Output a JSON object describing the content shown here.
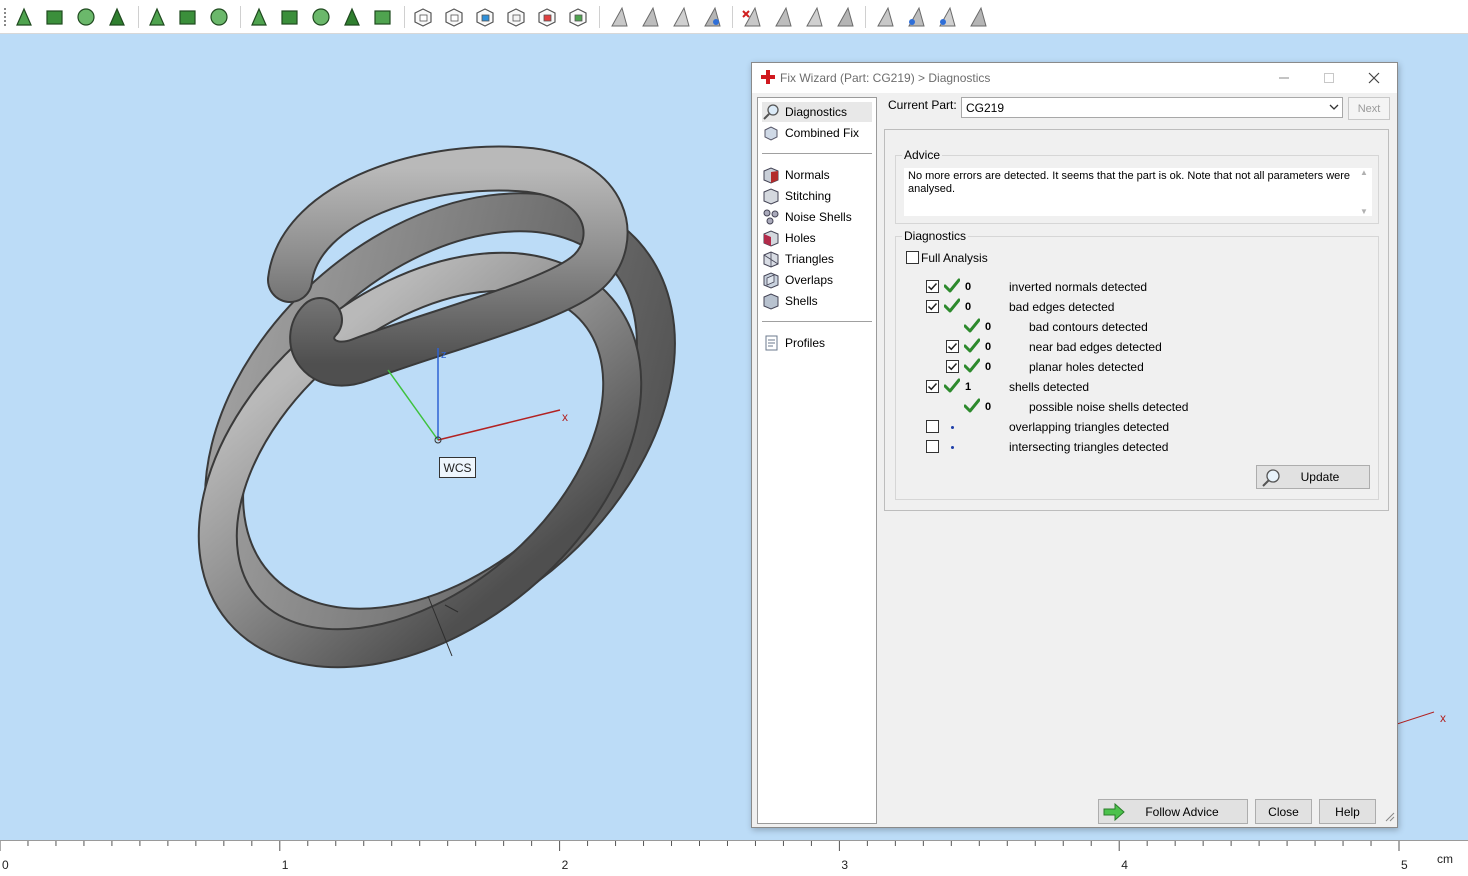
{
  "toolbar": {
    "groups": [
      [
        "arrow-select-icon",
        "face-select-icon",
        "edge-select-icon",
        "shell-select-icon"
      ],
      [
        "plane-select-icon",
        "connected-select-icon",
        "curve-select-icon"
      ],
      [
        "triangle-select-icon",
        "surface-select-icon",
        "star-select-icon",
        "radial-select-icon",
        "sector-select-icon"
      ],
      [
        "box-view-icon",
        "cube-view-icon",
        "cube-color-icon",
        "wire-cube-icon",
        "cube-red-icon",
        "cube-green-icon"
      ],
      [
        "triangle-tool-1-icon",
        "triangle-tool-2-icon",
        "triangle-tool-3-icon",
        "triangle-warning-icon"
      ],
      [
        "triangle-delete-icon",
        "triangle-tool-4-icon",
        "triangle-tool-5-icon",
        "triangle-tool-6-icon"
      ],
      [
        "triangle-outline-icon",
        "triangle-blue-icon",
        "triangle-point-icon",
        "triangle-gray-icon"
      ]
    ]
  },
  "viewport": {
    "axis_x_label": "x",
    "axis_z_label": "z",
    "wcs_label": "WCS",
    "far_axis_label": "x"
  },
  "ruler": {
    "labels": [
      "0",
      "1",
      "2",
      "3",
      "4",
      "5"
    ],
    "unit": "cm"
  },
  "dialog": {
    "title": "Fix Wizard (Part: CG219) > Diagnostics",
    "nav": {
      "top": [
        {
          "label": "Diagnostics",
          "icon": "magnifier-icon",
          "active": true
        },
        {
          "label": "Combined Fix",
          "icon": "combined-fix-icon",
          "active": false
        }
      ],
      "fixes": [
        {
          "label": "Normals",
          "icon": "normals-icon"
        },
        {
          "label": "Stitching",
          "icon": "stitching-icon"
        },
        {
          "label": "Noise Shells",
          "icon": "noise-shells-icon"
        },
        {
          "label": "Holes",
          "icon": "holes-icon"
        },
        {
          "label": "Triangles",
          "icon": "triangles-icon"
        },
        {
          "label": "Overlaps",
          "icon": "overlaps-icon"
        },
        {
          "label": "Shells",
          "icon": "shells-icon"
        }
      ],
      "bottom": [
        {
          "label": "Profiles",
          "icon": "profiles-icon"
        }
      ]
    },
    "current_part_label": "Current Part:",
    "current_part_value": "CG219",
    "next_label": "Next",
    "advice_title": "Advice",
    "advice_text": "No more errors are detected. It seems that the part is ok. Note that not all parameters were analysed.",
    "diagnostics_title": "Diagnostics",
    "full_analysis_label": "Full Analysis",
    "full_analysis_checked": false,
    "rows": [
      {
        "checkbox": true,
        "checked": true,
        "status": "ok",
        "count": "0",
        "indent": 0,
        "text": "inverted normals detected"
      },
      {
        "checkbox": true,
        "checked": true,
        "status": "ok",
        "count": "0",
        "indent": 0,
        "text": "bad edges detected"
      },
      {
        "checkbox": false,
        "checked": false,
        "status": "ok",
        "count": "0",
        "indent": 1,
        "text": "bad contours detected"
      },
      {
        "checkbox": true,
        "checked": true,
        "status": "ok",
        "count": "0",
        "indent": 1,
        "text": "near bad edges detected"
      },
      {
        "checkbox": true,
        "checked": true,
        "status": "ok",
        "count": "0",
        "indent": 1,
        "text": "planar holes detected"
      },
      {
        "checkbox": true,
        "checked": true,
        "status": "ok",
        "count": "1",
        "indent": 0,
        "text": "shells detected"
      },
      {
        "checkbox": false,
        "checked": false,
        "status": "ok",
        "count": "0",
        "indent": 1,
        "text": "possible noise shells detected"
      },
      {
        "checkbox": true,
        "checked": false,
        "status": "pending",
        "count": "",
        "indent": 0,
        "text": "overlapping triangles detected"
      },
      {
        "checkbox": true,
        "checked": false,
        "status": "pending",
        "count": "",
        "indent": 0,
        "text": "intersecting triangles detected"
      }
    ],
    "update_label": "Update",
    "follow_advice_label": "Follow Advice",
    "close_label": "Close",
    "help_label": "Help"
  },
  "colors": {
    "viewport_bg": "#bcdcf7",
    "ok_check": "#2d8a2d",
    "axis_x": "#b22222",
    "axis_y": "#3ec23e",
    "axis_z": "#2f63d3"
  }
}
